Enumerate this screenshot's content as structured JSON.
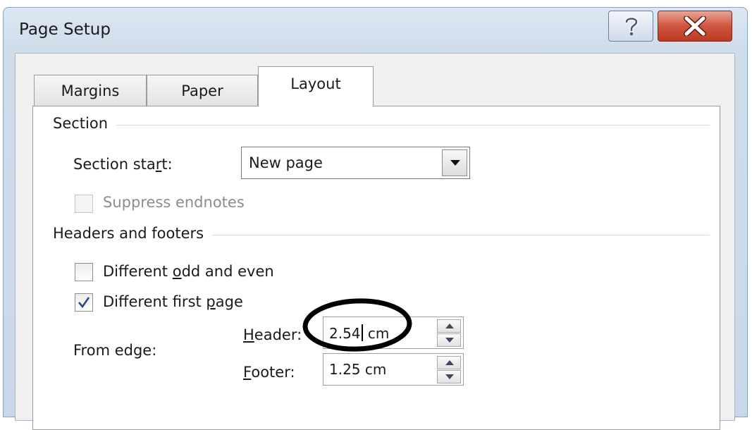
{
  "window": {
    "title": "Page Setup"
  },
  "tabs": [
    {
      "label": "Margins",
      "active": false
    },
    {
      "label": "Paper",
      "active": false
    },
    {
      "label": "Layout",
      "active": true
    }
  ],
  "section": {
    "title": "Section",
    "start_label_pre": "Section sta",
    "start_label_u": "r",
    "start_label_post": "t:",
    "start_value": "New page",
    "suppress_endnotes": {
      "label": "Suppress endnotes",
      "checked": false,
      "disabled": true
    }
  },
  "headers_footers": {
    "title": "Headers and footers",
    "odd_even": {
      "pre": "Different ",
      "u": "o",
      "post": "dd and even",
      "checked": false
    },
    "first_page": {
      "pre": "Different first ",
      "u": "p",
      "post": "age",
      "checked": true
    },
    "from_edge_label": "From edge:",
    "header": {
      "u": "H",
      "post": "eader:",
      "value_pre": "2.54",
      "value_post": " cm"
    },
    "footer": {
      "u": "F",
      "post": "ooter:",
      "value": "1.25 cm"
    }
  },
  "colors": {
    "close_button": "#c94a32",
    "annotation_circle": "#000000"
  }
}
